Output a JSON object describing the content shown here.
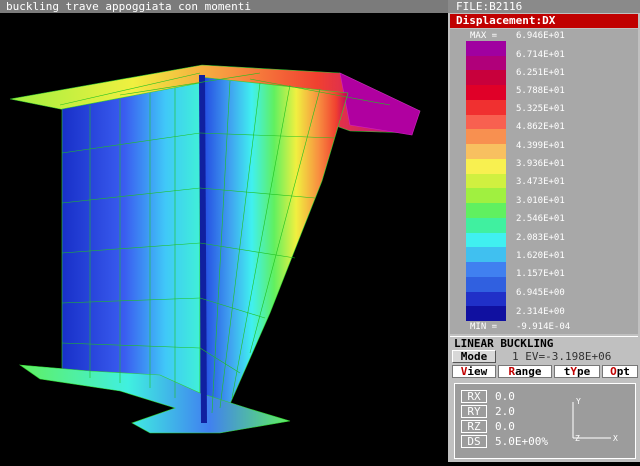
{
  "window": {
    "title": "buckling trave appoggiata con momenti"
  },
  "panel": {
    "file_label": "FILE:B2116",
    "result_label": "Displacement:DX",
    "legend": {
      "max_label": "MAX =",
      "min_label": "MIN =",
      "values": [
        "6.946E+01",
        "6.714E+01",
        "6.251E+01",
        "5.788E+01",
        "5.325E+01",
        "4.862E+01",
        "4.399E+01",
        "3.936E+01",
        "3.473E+01",
        "3.010E+01",
        "2.546E+01",
        "2.083E+01",
        "1.620E+01",
        "1.157E+01",
        "6.945E+00",
        "2.314E+00",
        "-9.914E-04"
      ]
    },
    "analysis_label": "LINEAR BUCKLING",
    "mode_button": "Mode",
    "eigen_text": "1 EV=-3.198E+06",
    "menu": [
      {
        "hot": "V",
        "rest": "iew"
      },
      {
        "hot": "R",
        "rest": "ange"
      },
      {
        "pre": "t",
        "hot": "Y",
        "rest": "pe"
      },
      {
        "hot": "O",
        "rest": "pt"
      }
    ],
    "rotation": {
      "rx_label": "RX",
      "rx_value": "0.0",
      "ry_label": "RY",
      "ry_value": "2.0",
      "rz_label": "RZ",
      "rz_value": "0.0",
      "ds_label": "DS",
      "ds_value": "5.0E+00%"
    },
    "triad": {
      "y": "Y",
      "z": "Z",
      "x": "X"
    }
  },
  "colors": {
    "header_red": "#c00000",
    "legend_bands": [
      "#a000a0",
      "#b0007a",
      "#c8003c",
      "#e00028",
      "#f03030",
      "#f86050",
      "#f89050",
      "#f8c060",
      "#f8f050",
      "#d0f040",
      "#a0f040",
      "#60f060",
      "#40f0a0",
      "#40f0f0",
      "#40c0f0",
      "#4080f0",
      "#3060e0",
      "#2030c8",
      "#1010a0"
    ]
  }
}
